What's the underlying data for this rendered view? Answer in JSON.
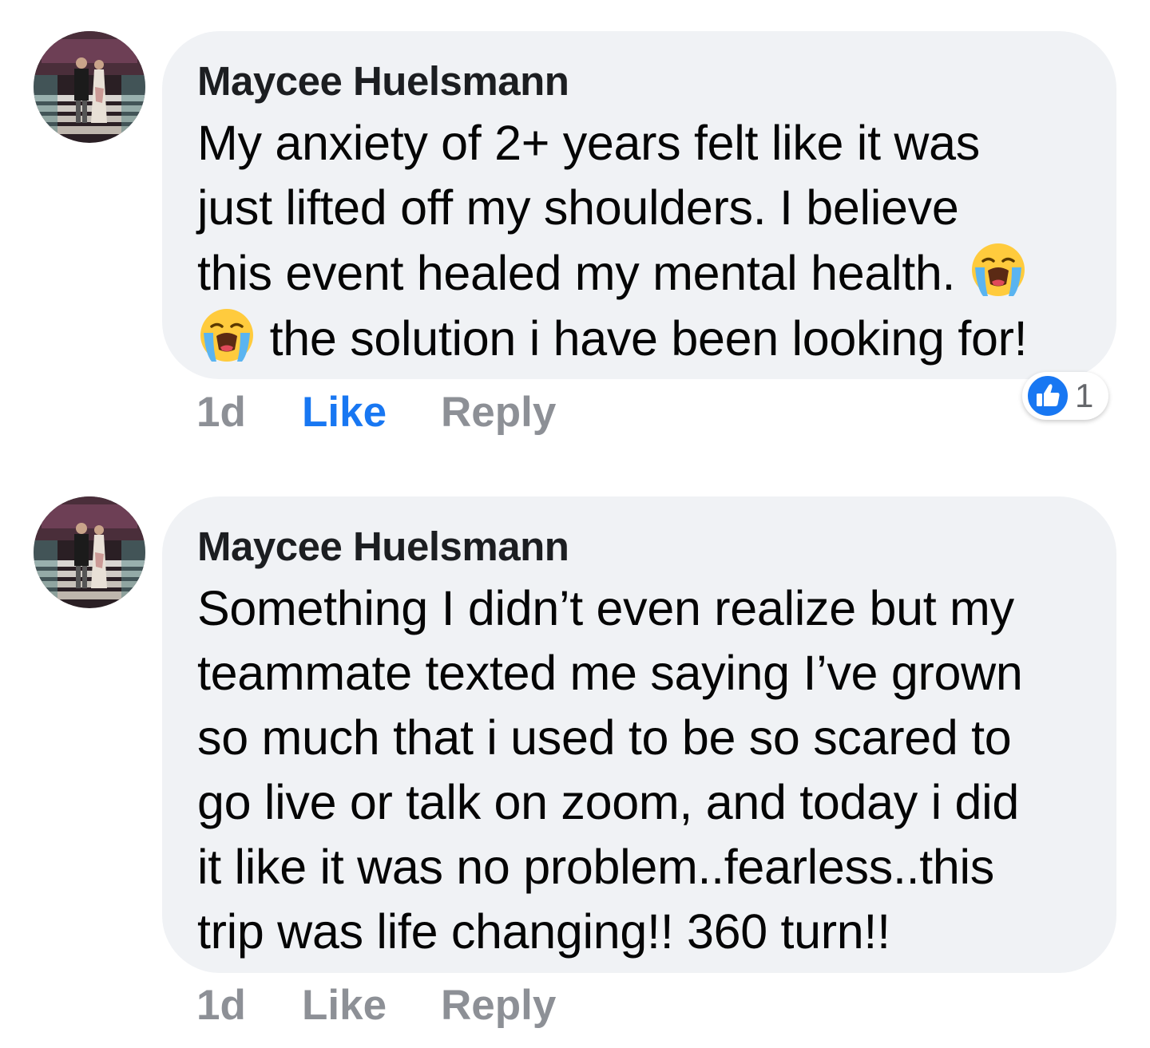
{
  "comments": [
    {
      "author": "Maycee Huelsmann",
      "lines": [
        "My anxiety of 2+ years felt like it was",
        "just lifted off my shoulders. I believe",
        "this event healed my mental health.",
        "the solution i have been looking for!"
      ],
      "emoji": "loudly-crying-face",
      "time": "1d",
      "like_label": "Like",
      "reply_label": "Reply",
      "liked": true,
      "reaction_count": "1"
    },
    {
      "author": "Maycee Huelsmann",
      "lines": [
        "Something I didn’t even realize but my",
        "teammate texted me saying I’ve grown",
        "so much that i used to be so scared to",
        "go live or talk on zoom, and today i did",
        "it like it was no problem..fearless..this",
        "trip was life changing!! 360 turn!!"
      ],
      "time": "1d",
      "like_label": "Like",
      "reply_label": "Reply",
      "liked": false
    }
  ],
  "colors": {
    "bubble": "#f0f2f5",
    "author": "#1c1e21",
    "body": "#050505",
    "meta": "#8d9096",
    "like_active": "#1877f2"
  }
}
